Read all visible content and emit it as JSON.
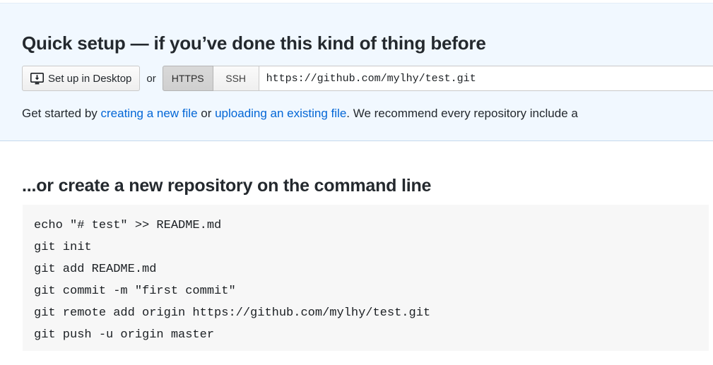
{
  "quick_setup": {
    "title": "Quick setup — if you’ve done this kind of thing before",
    "desktop_button_label": "Set up in Desktop",
    "desktop_icon_name": "desktop-download-icon",
    "or_label": "or",
    "protocol_https_label": "HTTPS",
    "protocol_ssh_label": "SSH",
    "protocol_selected": "HTTPS",
    "clone_url": "https://github.com/mylhy/test.git",
    "get_started": {
      "prefix": "Get started by ",
      "link_create": "creating a new file",
      "middle": " or ",
      "link_upload": "uploading an existing file",
      "suffix": ". We recommend every repository include a"
    }
  },
  "command_line": {
    "title": "...or create a new repository on the command line",
    "lines": [
      "echo \"# test\" >> README.md",
      "git init",
      "git add README.md",
      "git commit -m \"first commit\"",
      "git remote add origin https://github.com/mylhy/test.git",
      "git push -u origin master"
    ]
  },
  "colors": {
    "panel_background": "#f1f8ff",
    "panel_border": "#c6d9ec",
    "link": "#0366d6",
    "text": "#24292e",
    "code_background": "#f7f7f7"
  }
}
